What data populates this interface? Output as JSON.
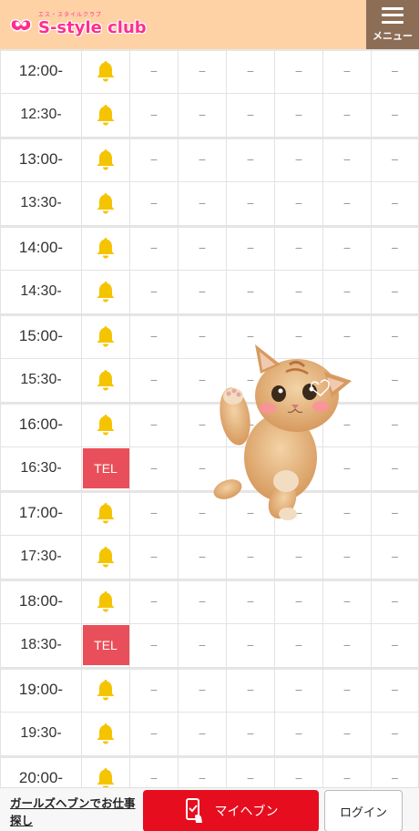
{
  "header": {
    "logo_sub": "エス・スタイルクラブ",
    "logo_main": "S-style club",
    "menu_label": "メニュー"
  },
  "colors": {
    "header_bg": "#ffd2a6",
    "menu_bg": "#8c6e57",
    "brand_pink": "#ff2e8f",
    "tel_red": "#e94f5a",
    "bell_yellow": "#f5c400",
    "myheaven_red": "#e60d1f"
  },
  "schedule": {
    "empty_mark": "−",
    "tel_label": "TEL",
    "rows": [
      {
        "time": "12:00-",
        "status": "bell"
      },
      {
        "time": "12:30-",
        "status": "bell"
      },
      {
        "time": "13:00-",
        "status": "bell"
      },
      {
        "time": "13:30-",
        "status": "bell"
      },
      {
        "time": "14:00-",
        "status": "bell"
      },
      {
        "time": "14:30-",
        "status": "bell"
      },
      {
        "time": "15:00-",
        "status": "bell"
      },
      {
        "time": "15:30-",
        "status": "bell"
      },
      {
        "time": "16:00-",
        "status": "bell"
      },
      {
        "time": "16:30-",
        "status": "tel"
      },
      {
        "time": "17:00-",
        "status": "bell"
      },
      {
        "time": "17:30-",
        "status": "bell"
      },
      {
        "time": "18:00-",
        "status": "bell"
      },
      {
        "time": "18:30-",
        "status": "tel"
      },
      {
        "time": "19:00-",
        "status": "bell"
      },
      {
        "time": "19:30-",
        "status": "bell"
      },
      {
        "time": "20:00-",
        "status": "bell"
      }
    ]
  },
  "footer": {
    "girls_link": "ガールズヘブンでお仕事探し",
    "myheaven_label": "マイヘブン",
    "login_label": "ログイン"
  }
}
